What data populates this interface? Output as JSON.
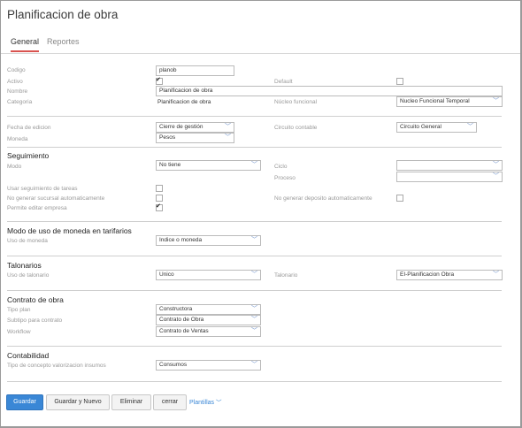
{
  "title": "Planificacion de obra",
  "tabs": [
    {
      "label": "General"
    },
    {
      "label": "Reportes"
    }
  ],
  "fields": {
    "codigo": {
      "label": "Codigo",
      "value": "planob"
    },
    "activo": {
      "label": "Activo",
      "checked": true
    },
    "default": {
      "label": "Default",
      "checked": false
    },
    "nombre": {
      "label": "Nombre",
      "value": "Planificacion de obra"
    },
    "categoria": {
      "label": "Categoria",
      "value": "Planificacion de obra"
    },
    "nucleo": {
      "label": "Núcleo funcional",
      "value": "Nucleo Funcional Temporal"
    },
    "fecha_edicion": {
      "label": "Fecha de edicion",
      "value": "Cierre de gestión"
    },
    "circuito": {
      "label": "Circuito contable",
      "value": "Circuito General"
    },
    "moneda": {
      "label": "Moneda",
      "value": "Pesos"
    }
  },
  "seguimiento": {
    "heading": "Seguimiento",
    "modo": {
      "label": "Modo",
      "value": "No tiene"
    },
    "ciclo": {
      "label": "Ciclo",
      "value": ""
    },
    "proceso": {
      "label": "Proceso",
      "value": ""
    },
    "usar_seguimiento": {
      "label": "Usar seguimiento de tareas",
      "checked": false
    },
    "no_gen_sucursal": {
      "label": "No generar sucursal automaticamente",
      "checked": false
    },
    "no_gen_deposito": {
      "label": "No generar deposito automaticamente",
      "checked": false
    },
    "permite_editar": {
      "label": "Permite editar empresa",
      "checked": true
    }
  },
  "modo_moneda": {
    "heading": "Modo de uso de moneda en tarifarios",
    "uso": {
      "label": "Uso de moneda",
      "value": "Indice o moneda"
    }
  },
  "talonarios": {
    "heading": "Talonarios",
    "uso": {
      "label": "Uso de talonario",
      "value": "Unico"
    },
    "talonario": {
      "label": "Talonario",
      "value": "EI-Planificacion Obra"
    }
  },
  "contrato": {
    "heading": "Contrato de obra",
    "tipo_plan": {
      "label": "Tipo plan",
      "value": "Constructora"
    },
    "subtipo": {
      "label": "Subtipo para contrato",
      "value": "Contrato de Obra"
    },
    "workflow": {
      "label": "Workflow",
      "value": "Contrato de Ventas"
    }
  },
  "contabilidad": {
    "heading": "Contabilidad",
    "tipo_concepto": {
      "label": "Tipo de concepto valorizacion insumos",
      "value": "Consumos"
    }
  },
  "buttons": {
    "guardar": "Guardar",
    "guardar_nuevo": "Guardar y Nuevo",
    "eliminar": "Eliminar",
    "cerrar": "cerrar",
    "plantillas": "Plantillas"
  },
  "colors": {
    "primary": "#3a87d6",
    "tab_accent": "#d9534f"
  }
}
